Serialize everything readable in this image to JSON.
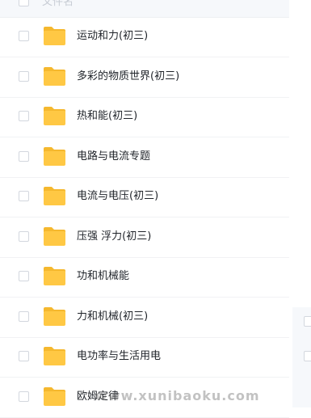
{
  "header": {
    "column_label": "文件名"
  },
  "rows": [
    {
      "name": "运动和力(初三)",
      "icon": "folder-icon"
    },
    {
      "name": "多彩的物质世界(初三)",
      "icon": "folder-icon"
    },
    {
      "name": "热和能(初三)",
      "icon": "folder-icon"
    },
    {
      "name": "电路与电流专题",
      "icon": "folder-icon"
    },
    {
      "name": "电流与电压(初三)",
      "icon": "folder-icon"
    },
    {
      "name": "压强 浮力(初三)",
      "icon": "folder-icon"
    },
    {
      "name": "功和机械能",
      "icon": "folder-icon"
    },
    {
      "name": "力和机械(初三)",
      "icon": "folder-icon"
    },
    {
      "name": "电功率与生活用电",
      "icon": "folder-icon"
    },
    {
      "name": "欧姆定律",
      "icon": "folder-icon"
    }
  ],
  "watermark": "www.xunibaoku.com",
  "colors": {
    "folder": "#ffc844",
    "folder_tab": "#f5b82e",
    "header_bg": "#f6f8fb",
    "text": "#1f2329"
  }
}
